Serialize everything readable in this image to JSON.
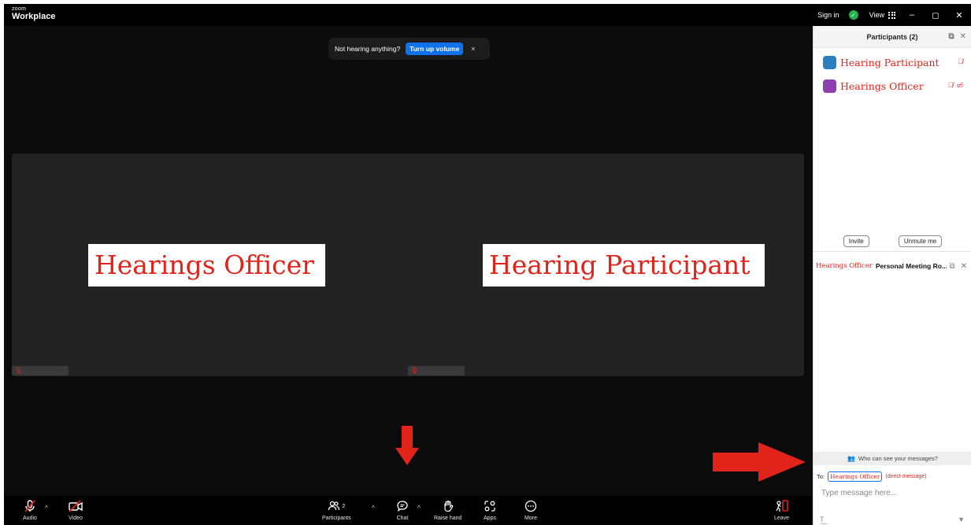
{
  "app": {
    "brand_small": "zoom",
    "brand_big": "Workplace"
  },
  "titlebar": {
    "sign_in": "Sign in",
    "view": "View",
    "minimize": "–",
    "maximize": "◻",
    "close": "✕"
  },
  "toast": {
    "message": "Not hearing anything?",
    "button": "Turn up volume",
    "close": "×"
  },
  "tiles": [
    {
      "name": "Hearings Officer"
    },
    {
      "name": "Hearing Participant"
    }
  ],
  "toolbar": {
    "audio": "Audio",
    "video": "Video",
    "participants": "Participants",
    "participants_count": "2",
    "chat": "Chat",
    "raise_hand": "Raise hand",
    "apps": "Apps",
    "more": "More",
    "leave": "Leave"
  },
  "participants_panel": {
    "title": "Participants (2)",
    "people": [
      {
        "name": "Hearing Participant",
        "avatar_color": "#2a7fc1"
      },
      {
        "name": "Hearings Officer",
        "avatar_color": "#8e3fb0"
      }
    ],
    "invite": "Invite",
    "unmute": "Unmute me"
  },
  "chat_panel": {
    "host": "Hearings Officer",
    "room": "Personal Meeting Ro...",
    "who_can_see": "Who can see your messages?",
    "to_label": "To:",
    "to_recipient": "Hearings Officer",
    "direct_message": "(direct message)",
    "placeholder": "Type message here..."
  },
  "colors": {
    "accent": "#0e72ed",
    "annotation_red": "#e2231a",
    "success": "#22b34b"
  }
}
